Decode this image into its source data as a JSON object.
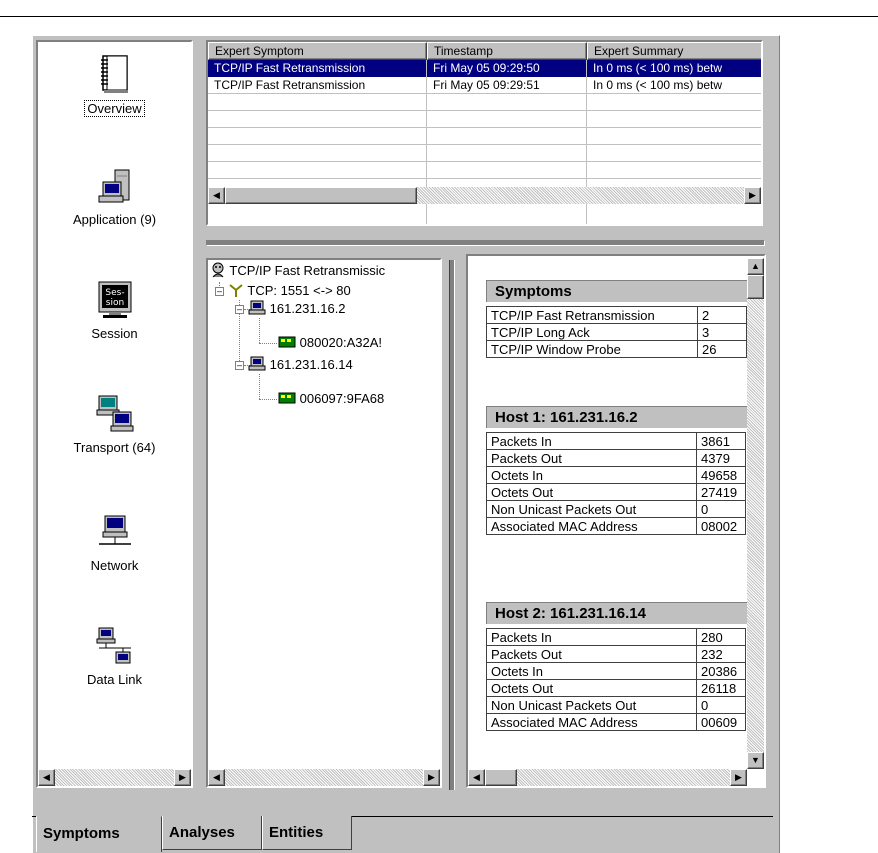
{
  "nav": {
    "items": [
      {
        "label": "Overview"
      },
      {
        "label": "Application (9)"
      },
      {
        "label": "Session"
      },
      {
        "label": "Transport (64)"
      },
      {
        "label": "Network"
      },
      {
        "label": "Data Link"
      }
    ]
  },
  "symptoms_table": {
    "columns": [
      "Expert Symptom",
      "Timestamp",
      "Expert Summary"
    ],
    "rows": [
      [
        "TCP/IP Fast Retransmission",
        "Fri May 05 09:29:50",
        "In 0 ms (< 100 ms) betw"
      ],
      [
        "TCP/IP Fast Retransmission",
        "Fri May 05 09:29:51",
        "In 0 ms (< 100 ms) betw"
      ]
    ]
  },
  "tree": {
    "root": "TCP/IP Fast Retransmissic",
    "conn": "TCP: 1551 <-> 80",
    "host1": "161.231.16.2",
    "mac1": "080020:A32A!",
    "host2": "161.231.16.14",
    "mac2": "006097:9FA68"
  },
  "details": {
    "symptoms_title": "Symptoms",
    "symptoms": [
      [
        "TCP/IP Fast Retransmission",
        "2"
      ],
      [
        "TCP/IP Long Ack",
        "3"
      ],
      [
        "TCP/IP Window Probe",
        "26"
      ]
    ],
    "host1_title": "Host 1: 161.231.16.2",
    "host1": [
      [
        "Packets In",
        "3861"
      ],
      [
        "Packets Out",
        "4379"
      ],
      [
        "Octets In",
        "49658"
      ],
      [
        "Octets Out",
        "27419"
      ],
      [
        "Non Unicast Packets Out",
        "0"
      ],
      [
        "Associated MAC Address",
        "08002"
      ]
    ],
    "host2_title": "Host 2: 161.231.16.14",
    "host2": [
      [
        "Packets In",
        "280"
      ],
      [
        "Packets Out",
        "232"
      ],
      [
        "Octets In",
        "20386"
      ],
      [
        "Octets Out",
        "26118"
      ],
      [
        "Non Unicast Packets Out",
        "0"
      ],
      [
        "Associated MAC Address",
        "00609"
      ]
    ]
  },
  "tabs": {
    "symptoms": "Symptoms",
    "analyses": "Analyses",
    "entities": "Entities"
  }
}
